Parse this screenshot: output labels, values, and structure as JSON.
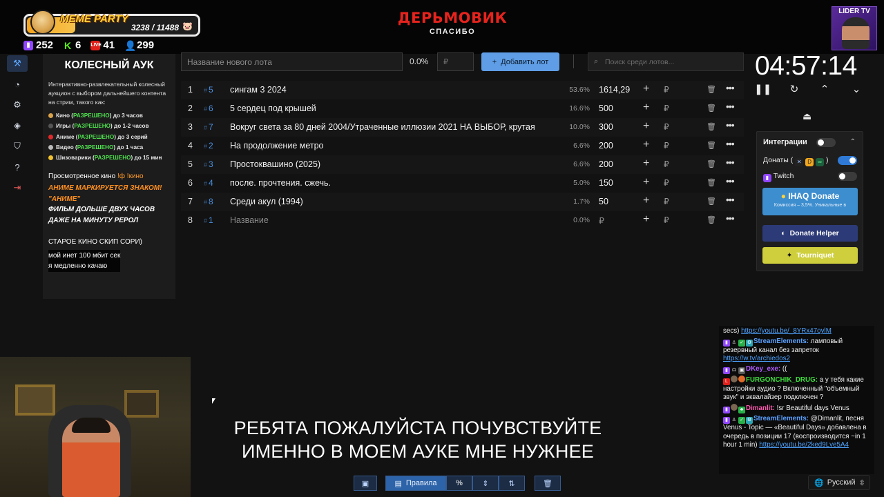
{
  "overlay": {
    "meme_title": "MEME PARTY",
    "meme_count": "3238 / 11488",
    "meme_progress": 0.28,
    "stats": [
      {
        "icon": "twitch-icon",
        "value": "252"
      },
      {
        "icon": "kick-icon",
        "value": "6"
      },
      {
        "icon": "vk-live-icon",
        "value": "41"
      },
      {
        "icon": "user-icon",
        "value": "299"
      }
    ],
    "brand_main": "ДЕРЬМОВИК",
    "brand_sub": "СПАСИБО",
    "lider": "LIDER TV"
  },
  "info": {
    "title": "КОЛЕСНЫЙ АУК",
    "description": "Интерактивно-развлекательный колесный аукцион с выбором дальнейшего контента на стрим, такого как:",
    "items": [
      {
        "label": "Кино",
        "status": "РАЗРЕШЕНО",
        "rest": "до 3 часов",
        "dot": "#d9a24a"
      },
      {
        "label": "Игры",
        "status": "РАЗРЕШЕНО",
        "rest": "до 1-2 часов",
        "dot": "#555555"
      },
      {
        "label": "Аниме",
        "status": "РАЗРЕШЕНО",
        "rest": "до 3 серий",
        "dot": "#e02a2a"
      },
      {
        "label": "Видео",
        "status": "РАЗРЕШЕНО",
        "rest": "до 1 часа",
        "dot": "#bbbbbb"
      },
      {
        "label": "Шизоварики",
        "status": "РАЗРЕШЕНО",
        "rest": "до 15 мин",
        "dot": "#f0c030"
      }
    ],
    "watched": "Просмотренное кино",
    "watched_cmd": "!ф !кино",
    "anime_line1": "АНИМЕ МАРКИРУЕТСЯ ЗНАКОМ!",
    "anime_line2": "\"АНИМЕ\"",
    "film_line1": "ФИЛЬМ ДОЛЬШЕ ДВУХ ЧАСОВ",
    "film_line2": "ДАЖЕ НА МИНУТУ РЕРОЛ",
    "old_movies": "СТАРОЕ КИНО СКИП СОРИ)",
    "net_line1": "мой инет 100 мбит сек",
    "net_line2": "я медленно качаю"
  },
  "toolbar": {
    "lot_placeholder": "Название нового лота",
    "percent": "0.0%",
    "rub_placeholder": "₽",
    "add_label": "Добавить лот",
    "search_placeholder": "Поиск среди лотов..."
  },
  "lots": [
    {
      "n": "1",
      "id": "5",
      "name": "сингам 3 2024",
      "pct": "53.6%",
      "amount": "1614,29"
    },
    {
      "n": "2",
      "id": "6",
      "name": "5 сердец под крышей",
      "pct": "16.6%",
      "amount": "500"
    },
    {
      "n": "3",
      "id": "7",
      "name": "Вокруг света за 80 дней 2004/Утраченные иллюзии 2021 НА ВЫБОР, крутая",
      "pct": "10.0%",
      "amount": "300"
    },
    {
      "n": "4",
      "id": "2",
      "name": "На продолжение метро",
      "pct": "6.6%",
      "amount": "200"
    },
    {
      "n": "5",
      "id": "3",
      "name": "Простоквашино (2025)",
      "pct": "6.6%",
      "amount": "200"
    },
    {
      "n": "6",
      "id": "4",
      "name": "после. прочтения. сжечь.",
      "pct": "5.0%",
      "amount": "150"
    },
    {
      "n": "7",
      "id": "8",
      "name": "Среди акул (1994)",
      "pct": "1.7%",
      "amount": "50"
    },
    {
      "n": "8",
      "id": "1",
      "name": "Название",
      "pct": "0.0%",
      "amount": "₽"
    }
  ],
  "lot_rub": "₽",
  "timer": "04:57:14",
  "integrations": {
    "title": "Интеграции",
    "donations_label": "Донаты (",
    "twitch_label": "Twitch",
    "ihaq_title": "IHAQ Donate",
    "ihaq_sub": "Комиссия – 3,5%. Уникальные в",
    "donate_helper": "Donate Helper",
    "tourniquet": "Tourniquet"
  },
  "subtitles": {
    "line1": "РЕБЯТА ПОЖАЛУЙСТА ПОЧУВСТВУЙТЕ",
    "line2": "ИМЕННО В МОЕМ АУКЕ МНЕ НУЖНЕЕ"
  },
  "bottom": {
    "rules_label": "Правила",
    "percent_symbol": "%"
  },
  "chat": {
    "m0_text": "secs)",
    "m0_link": "https://youtu.be/_8YRx47oylM",
    "m1_user": "StreamElements:",
    "m1_text": "ламповый резервный канал без запреток",
    "m1_link": "https://w.tv/archiedos2",
    "m2_user": "DKey_exe:",
    "m2_text": "((",
    "m3_user": "FURGONCHIK_DRUG:",
    "m3_text": "а у тебя какие настройки аудио ? Включенный \"объемный звук\" и эквалайзер подключен ?",
    "m4_user": "Dimanlit:",
    "m4_text": "!sr Beautiful days Venus",
    "m5_user": "StreamElements:",
    "m5_text": "@Dimanlit, песня Venus - Topic — «Beautiful Days» добавлена в очередь в позиции 17 (воспроизводится ~in 1 hour 1 min)",
    "m5_link": "https://youtu.be/2ked9Lve5A4"
  },
  "language": "Русский"
}
